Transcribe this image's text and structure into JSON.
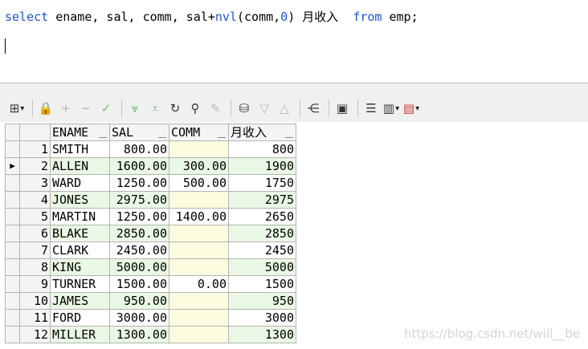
{
  "editor": {
    "sql": {
      "kw_select": "select",
      "cols": " ename, sal, comm, sal+",
      "fn": "nvl",
      "args_open": "(comm,",
      "zero": "0",
      "alias": ") 月收入  ",
      "kw_from": "from",
      "table": " emp;"
    }
  },
  "toolbar": {
    "icons": [
      "grid-layout-icon",
      "lock-icon",
      "add-icon",
      "remove-icon",
      "check-icon",
      "sort-desc-icon",
      "sort-asc-icon",
      "refresh-icon",
      "find-icon",
      "clear-icon",
      "query-icon",
      "down-icon",
      "up-icon",
      "tree-icon",
      "save-icon",
      "database-icon",
      "chart-icon",
      "table-icon"
    ]
  },
  "grid": {
    "headers": [
      "ENAME",
      "SAL",
      "COMM",
      "月收入"
    ],
    "current_row": 2,
    "rows": [
      {
        "n": "1",
        "ename": "SMITH",
        "sal": "800.00",
        "comm": "",
        "inc": "800"
      },
      {
        "n": "2",
        "ename": "ALLEN",
        "sal": "1600.00",
        "comm": "300.00",
        "inc": "1900"
      },
      {
        "n": "3",
        "ename": "WARD",
        "sal": "1250.00",
        "comm": "500.00",
        "inc": "1750"
      },
      {
        "n": "4",
        "ename": "JONES",
        "sal": "2975.00",
        "comm": "",
        "inc": "2975"
      },
      {
        "n": "5",
        "ename": "MARTIN",
        "sal": "1250.00",
        "comm": "1400.00",
        "inc": "2650"
      },
      {
        "n": "6",
        "ename": "BLAKE",
        "sal": "2850.00",
        "comm": "",
        "inc": "2850"
      },
      {
        "n": "7",
        "ename": "CLARK",
        "sal": "2450.00",
        "comm": "",
        "inc": "2450"
      },
      {
        "n": "8",
        "ename": "KING",
        "sal": "5000.00",
        "comm": "",
        "inc": "5000"
      },
      {
        "n": "9",
        "ename": "TURNER",
        "sal": "1500.00",
        "comm": "0.00",
        "inc": "1500"
      },
      {
        "n": "10",
        "ename": "JAMES",
        "sal": "950.00",
        "comm": "",
        "inc": "950"
      },
      {
        "n": "11",
        "ename": "FORD",
        "sal": "3000.00",
        "comm": "",
        "inc": "3000"
      },
      {
        "n": "12",
        "ename": "MILLER",
        "sal": "1300.00",
        "comm": "",
        "inc": "1300"
      }
    ]
  },
  "watermark": "https://blog.csdn.net/will__be"
}
